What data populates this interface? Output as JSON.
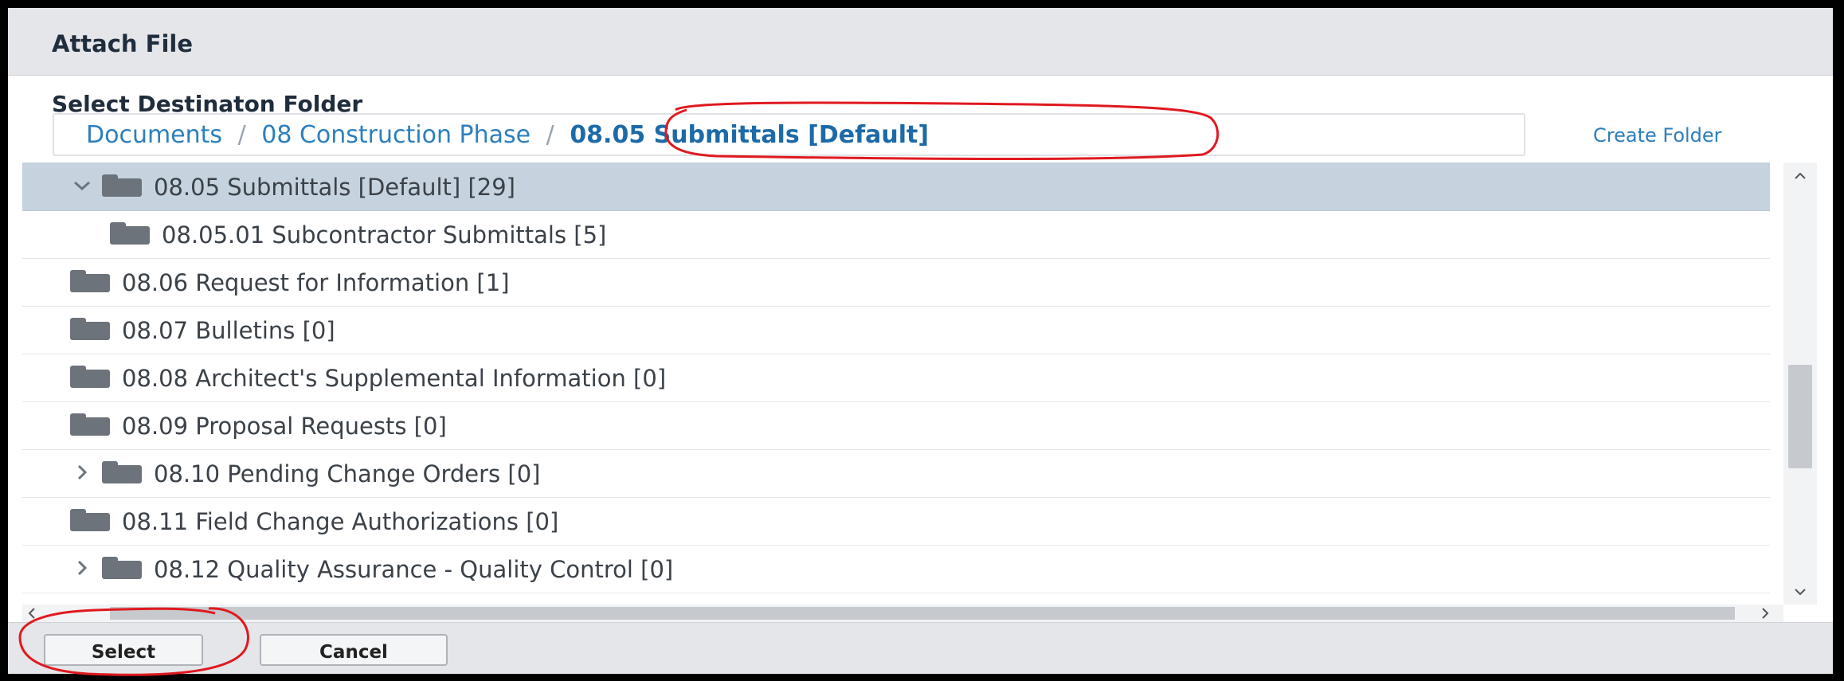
{
  "dialog": {
    "title": "Attach File",
    "destination_label": "Select Destinaton Folder",
    "breadcrumb": {
      "items": [
        "Documents",
        "08 Construction Phase"
      ],
      "separator": "/",
      "current": "08.05 Submittals [Default]"
    },
    "create_folder_label": "Create Folder"
  },
  "tree": {
    "rows": [
      {
        "label": "08.05 Submittals [Default] [29]",
        "expander": "expanded",
        "selected": true
      },
      {
        "label": "08.05.01 Subcontractor Submittals [5]",
        "expander": "none",
        "selected": false
      },
      {
        "label": "08.06 Request for Information [1]",
        "expander": "none",
        "selected": false
      },
      {
        "label": "08.07 Bulletins [0]",
        "expander": "none",
        "selected": false
      },
      {
        "label": "08.08 Architect's Supplemental Information [0]",
        "expander": "none",
        "selected": false
      },
      {
        "label": "08.09 Proposal Requests [0]",
        "expander": "none",
        "selected": false
      },
      {
        "label": "08.10 Pending Change Orders [0]",
        "expander": "collapsed",
        "selected": false
      },
      {
        "label": "08.11 Field Change Authorizations [0]",
        "expander": "none",
        "selected": false
      },
      {
        "label": "08.12 Quality Assurance - Quality Control [0]",
        "expander": "collapsed",
        "selected": false
      }
    ]
  },
  "footer": {
    "select_label": "Select",
    "cancel_label": "Cancel"
  },
  "icons": {
    "folder": "folder-icon",
    "expanded": "chevron-down-icon",
    "collapsed": "chevron-right-icon"
  },
  "colors": {
    "link": "#2c7fbd",
    "selected_row": "#c6d3df",
    "annotation": "#e0191f"
  }
}
